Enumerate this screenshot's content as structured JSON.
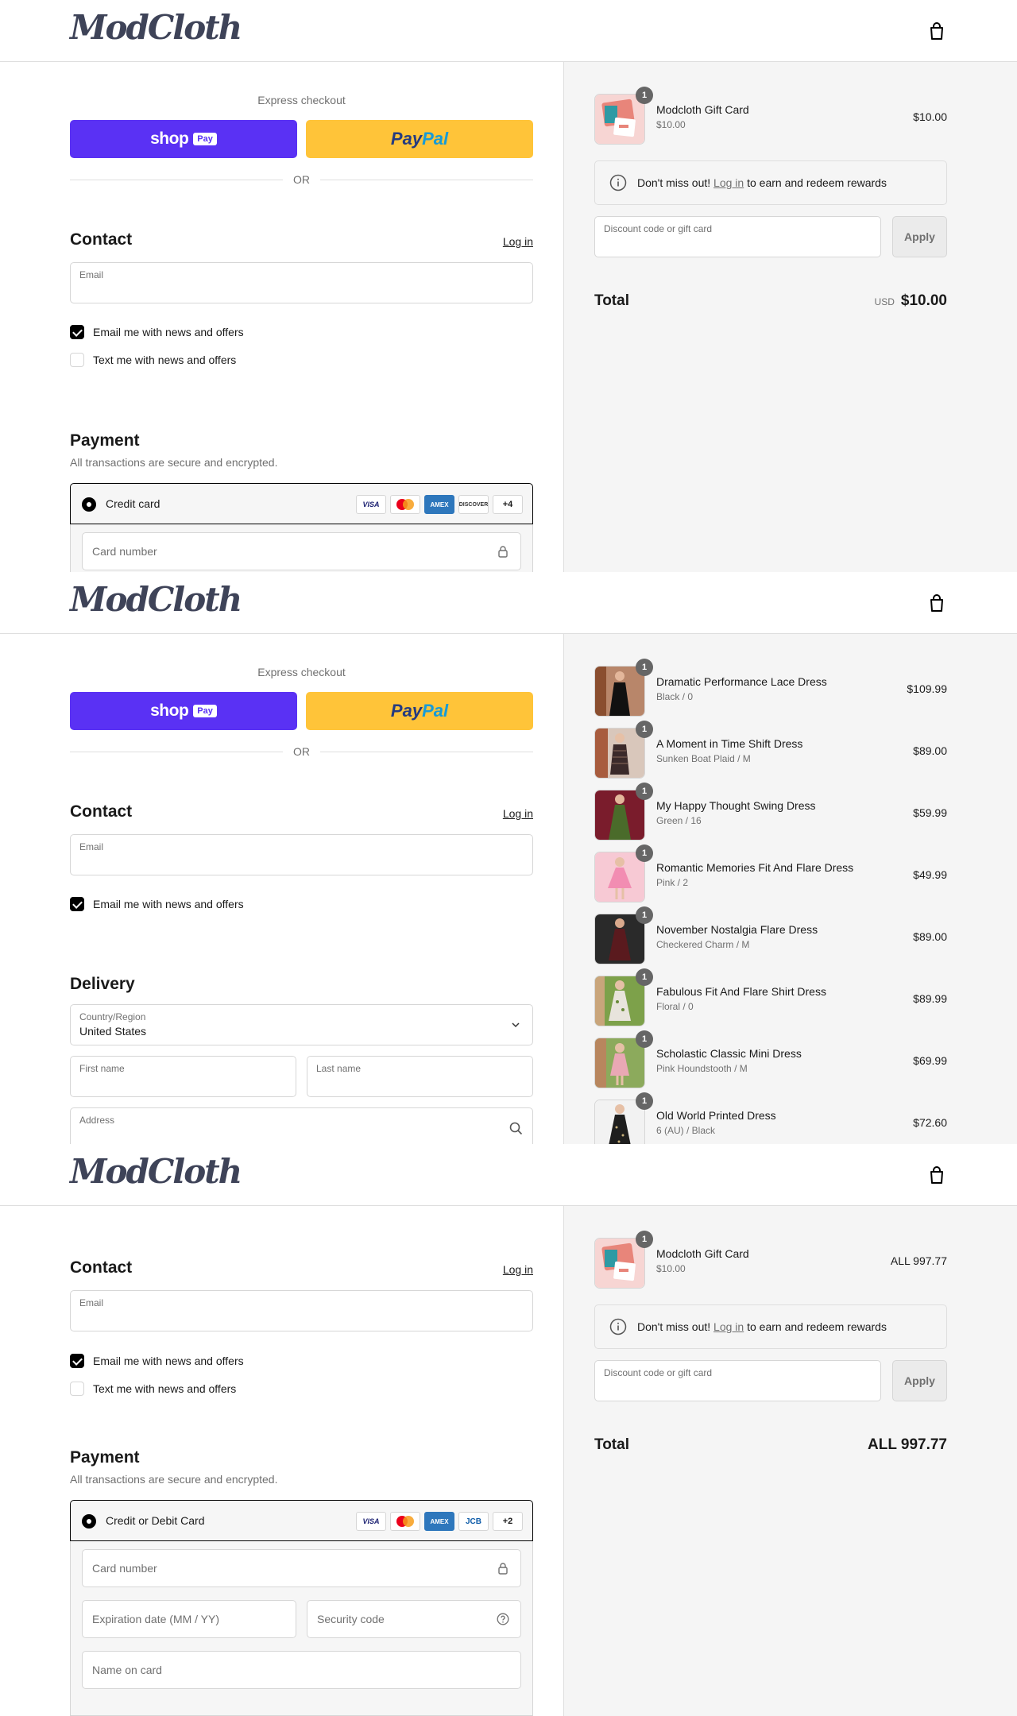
{
  "brand": {
    "name": "ModCloth"
  },
  "screens": [
    {
      "express": {
        "label": "Express checkout",
        "shoppay_word": "shop",
        "shoppay_badge": "Pay",
        "paypal_a": "Pay",
        "paypal_b": "Pal",
        "or": "OR"
      },
      "contact": {
        "title": "Contact",
        "login": "Log in",
        "email_label": "Email",
        "opt_email": "Email me with news and offers",
        "opt_text": "Text me with news and offers"
      },
      "payment": {
        "title": "Payment",
        "subtitle": "All transactions are secure and encrypted.",
        "method": "Credit card",
        "card_more": "+4",
        "card_number_ph": "Card number"
      },
      "summary": {
        "item": {
          "name": "Modcloth Gift Card",
          "variant": "$10.00",
          "price": "$10.00",
          "qty": "1"
        },
        "rewards_pre": "Don't miss out!",
        "rewards_link": "Log in",
        "rewards_post": "to earn and redeem rewards",
        "discount_label": "Discount code or gift card",
        "apply": "Apply",
        "total_label": "Total",
        "total_currency": "USD",
        "total_value": "$10.00"
      }
    },
    {
      "express": {
        "label": "Express checkout",
        "shoppay_word": "shop",
        "shoppay_badge": "Pay",
        "paypal_a": "Pay",
        "paypal_b": "Pal",
        "or": "OR"
      },
      "contact": {
        "title": "Contact",
        "login": "Log in",
        "email_label": "Email",
        "opt_email": "Email me with news and offers"
      },
      "delivery": {
        "title": "Delivery",
        "country_label": "Country/Region",
        "country_value": "United States",
        "first_name": "First name",
        "last_name": "Last name",
        "address": "Address"
      },
      "items": [
        {
          "name": "Dramatic Performance Lace Dress",
          "variant": "Black / 0",
          "price": "$109.99",
          "qty": "1"
        },
        {
          "name": "A Moment in Time Shift Dress",
          "variant": "Sunken Boat Plaid / M",
          "price": "$89.00",
          "qty": "1"
        },
        {
          "name": "My Happy Thought Swing Dress",
          "variant": "Green / 16",
          "price": "$59.99",
          "qty": "1"
        },
        {
          "name": "Romantic Memories Fit And Flare Dress",
          "variant": "Pink / 2",
          "price": "$49.99",
          "qty": "1"
        },
        {
          "name": "November Nostalgia Flare Dress",
          "variant": "Checkered Charm / M",
          "price": "$89.00",
          "qty": "1"
        },
        {
          "name": "Fabulous Fit And Flare Shirt Dress",
          "variant": "Floral / 0",
          "price": "$89.99",
          "qty": "1"
        },
        {
          "name": "Scholastic Classic Mini Dress",
          "variant": "Pink Houndstooth / M",
          "price": "$69.99",
          "qty": "1"
        },
        {
          "name": "Old World Printed Dress",
          "variant": "6 (AU) / Black",
          "price": "$72.60",
          "qty": "1"
        }
      ]
    },
    {
      "contact": {
        "title": "Contact",
        "login": "Log in",
        "email_label": "Email",
        "opt_email": "Email me with news and offers",
        "opt_text": "Text me with news and offers"
      },
      "payment": {
        "title": "Payment",
        "subtitle": "All transactions are secure and encrypted.",
        "method": "Credit or Debit Card",
        "card_more": "+2",
        "card_number_ph": "Card number",
        "expiry_ph": "Expiration date (MM / YY)",
        "cvc_ph": "Security code",
        "name_ph": "Name on card"
      },
      "summary": {
        "item": {
          "name": "Modcloth Gift Card",
          "variant": "$10.00",
          "price": "ALL 997.77",
          "qty": "1"
        },
        "rewards_pre": "Don't miss out!",
        "rewards_link": "Log in",
        "rewards_post": "to earn and redeem rewards",
        "discount_label": "Discount code or gift card",
        "apply": "Apply",
        "total_label": "Total",
        "total_value": "ALL 997.77"
      }
    }
  ],
  "card_brands": {
    "visa": "VISA",
    "amex": "AMEX",
    "discover": "DISCOVER",
    "jcb": "JCB"
  },
  "colors": {
    "shoppay": "#5a31f4",
    "paypal": "#ffc439",
    "summary_bg": "#f5f5f5",
    "logo": "#3e4358"
  }
}
